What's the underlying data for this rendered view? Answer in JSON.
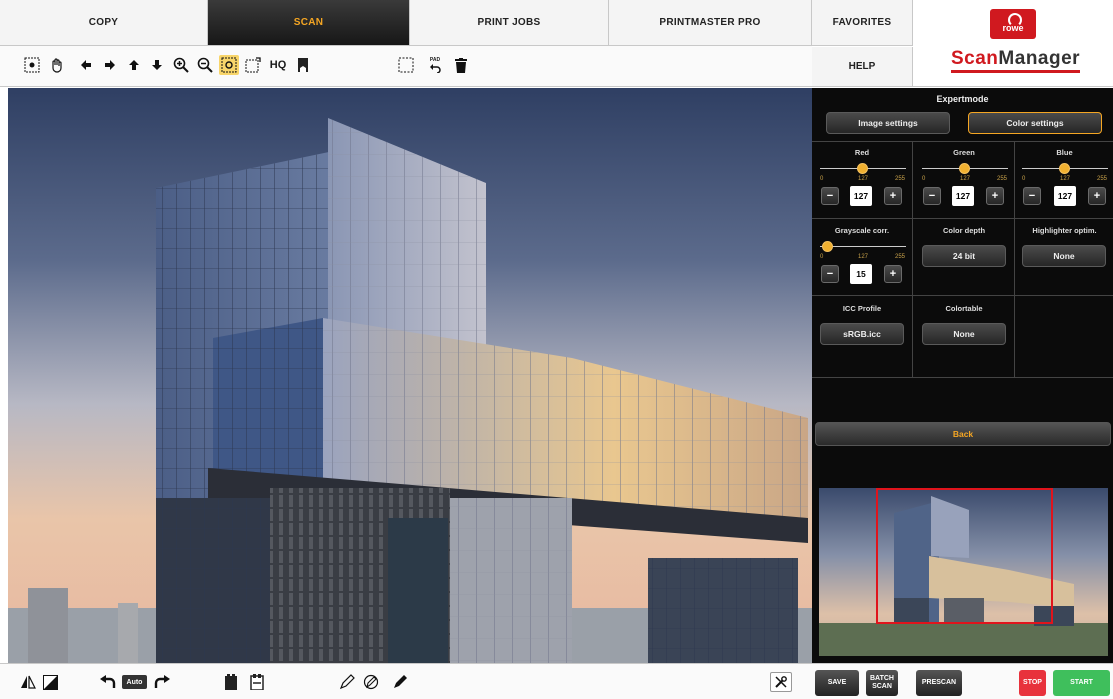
{
  "tabs": [
    "COPY",
    "SCAN",
    "PRINT JOBS",
    "PRINTMASTER PRO",
    "FAVORITES"
  ],
  "active_tab": "SCAN",
  "help_label": "HELP",
  "logo": {
    "badge": "rowe",
    "name_red": "Scan",
    "name_dark": "Manager"
  },
  "toolbar": {
    "hq_label": "HQ",
    "pad_label": "PAD"
  },
  "panel": {
    "title": "Expertmode",
    "image_settings": "Image settings",
    "color_settings": "Color settings",
    "red": {
      "label": "Red",
      "min": "0",
      "mid": "127",
      "max": "255",
      "value": "127"
    },
    "green": {
      "label": "Green",
      "min": "0",
      "mid": "127",
      "max": "255",
      "value": "127"
    },
    "blue": {
      "label": "Blue",
      "min": "0",
      "mid": "127",
      "max": "255",
      "value": "127"
    },
    "grayscale": {
      "label": "Grayscale corr.",
      "min": "0",
      "mid": "127",
      "max": "255",
      "value": "15"
    },
    "color_depth": {
      "label": "Color depth",
      "value": "24 bit"
    },
    "highlighter": {
      "label": "Highlighter optim.",
      "value": "None"
    },
    "icc": {
      "label": "ICC Profile",
      "value": "sRGB.icc"
    },
    "colortable": {
      "label": "Colortable",
      "value": "None"
    },
    "back": "Back"
  },
  "bottom": {
    "auto": "Auto",
    "save": "SAVE",
    "batch_scan": "BATCH SCAN",
    "prescan": "PRESCAN",
    "stop": "STOP",
    "start": "START"
  },
  "colors": {
    "accent": "#f5a623",
    "stop": "#e8323c",
    "start": "#3fbf5c",
    "frame": "#e0141c"
  }
}
